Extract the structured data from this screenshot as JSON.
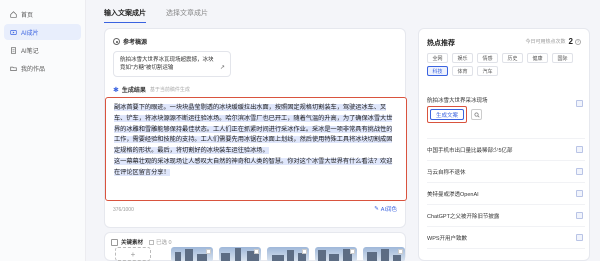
{
  "sidebar": {
    "items": [
      {
        "label": "首页",
        "icon": "home-icon",
        "active": false
      },
      {
        "label": "AI成片",
        "icon": "video-icon",
        "active": true
      },
      {
        "label": "AI笔记",
        "icon": "note-icon",
        "active": false
      },
      {
        "label": "我的作品",
        "icon": "folder-icon",
        "active": false
      }
    ]
  },
  "tabs": [
    {
      "label": "输入文案成片",
      "active": true
    },
    {
      "label": "选择文章成片",
      "active": false
    }
  ],
  "reference": {
    "heading": "参考稿源",
    "text_line1": "航拍冰雪大世界冰瓦现场超震撼，冰块",
    "text_line2": "竟如\"方糖\"被切割运输",
    "link_icon": "↗"
  },
  "generate": {
    "heading": "生成结果",
    "subheading": "基于当前稿件生成",
    "paragraphs": [
      "副冰首要下的眼迹。一块块晶莹剔透的冰块缓缓拉出水面，按照固定规格切割装车，驾驶运冰车、叉车、铲车，将冰块源源不断运往验冰场。哈尔滨冰雪厂也已开工，随着气温的升高，为了确保冰雪大世界的冰雕和雪雕能够保持最佳状态。工人们正在抓紧时间进行采冰作业。采冰是一项非常具有挑战性的工作，需要经验和技能的支持。工人们需要先用冰锯在冰面上划线，然后使用特殊工具将冰块切割成固定规格的形状。最后，将切割好的冰块装车运往验冰场。",
      "这一幕幕壮观的采冰现场让人感叹大自然的神奇和人类的智慧。你对这个冰雪大世界有什么看法？欢迎在评论区留言分享！"
    ],
    "count": "376/1000",
    "polish_label": "AI润色"
  },
  "materials": {
    "heading": "关键素材",
    "selected": "已选 0"
  },
  "hot": {
    "title": "热点推荐",
    "remain_label": "今日可用热点次数",
    "remain_count": "2",
    "categories": [
      "全网",
      "娱乐",
      "情感",
      "历史",
      "健康",
      "国际",
      "科技",
      "体育",
      "汽车"
    ],
    "active_category": "科技",
    "items": [
      "航拍冰雪大世界采冰现场",
      "中国手机市出口量比最稀部少5亿部",
      "马云自称不退休",
      "美特曼或渗透OpenAI",
      "ChatGPT之父被开除旧节披露",
      "WPS开用户致歉"
    ],
    "generate_button": "生成文案"
  },
  "colors": {
    "accent": "#3a63e0",
    "highlight_border": "#d9533e",
    "selection_bg": "#dfe6fb"
  }
}
